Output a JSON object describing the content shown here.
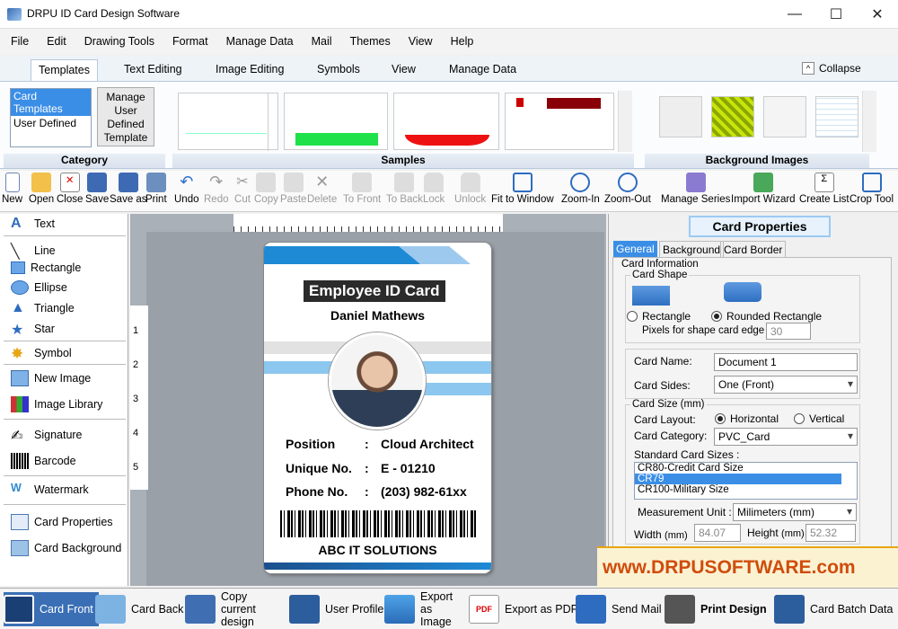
{
  "window": {
    "title": "DRPU ID Card Design Software",
    "minimize": "—",
    "maximize": "☐",
    "close": "✕"
  },
  "menu": [
    "File",
    "Edit",
    "Drawing Tools",
    "Format",
    "Manage Data",
    "Mail",
    "Themes",
    "View",
    "Help"
  ],
  "ribbon_tabs": [
    "Templates",
    "Text Editing",
    "Image Editing",
    "Symbols",
    "View",
    "Manage Data"
  ],
  "collapse_label": "Collapse",
  "category": {
    "items": [
      "Card Templates",
      "User Defined"
    ],
    "manage_button": "Manage User Defined Template",
    "label": "Category"
  },
  "samples_label": "Samples",
  "background_images_label": "Background Images",
  "toolbar": [
    "New",
    "Open",
    "Close",
    "Save",
    "Save as",
    "Print",
    "Undo",
    "Redo",
    "Cut",
    "Copy",
    "Paste",
    "Delete",
    "To Front",
    "To Back",
    "Lock",
    "Unlock",
    "Fit to Window",
    "Zoom-In",
    "Zoom-Out",
    "Manage Series",
    "Import Wizard",
    "Create List",
    "Crop Tool"
  ],
  "tools": [
    "Text",
    "Line",
    "Rectangle",
    "Ellipse",
    "Triangle",
    "Star",
    "Symbol",
    "New Image",
    "Image Library",
    "Signature",
    "Barcode",
    "Watermark",
    "Card Properties",
    "Card Background"
  ],
  "ruler_left": [
    "1",
    "2",
    "3",
    "4",
    "5"
  ],
  "card": {
    "title": "Employee ID Card",
    "name": "Daniel Mathews",
    "rows": [
      {
        "label": "Position",
        "value": "Cloud Architect"
      },
      {
        "label": "Unique No.",
        "value": "E - 01210"
      },
      {
        "label": "Phone No.",
        "value": "(203) 982-61xx"
      }
    ],
    "company": "ABC IT SOLUTIONS",
    "colors": {
      "accent": "#1e8ad6",
      "dark": "#1b4f8e",
      "title_bg": "#2b2b2b"
    }
  },
  "properties": {
    "header": "Card Properties",
    "tabs": [
      "General",
      "Background",
      "Card Border"
    ],
    "card_information": "Card Information",
    "card_shape": "Card Shape",
    "shape_rect": "Rectangle",
    "shape_round": "Rounded Rectangle",
    "pixels_label": "Pixels for shape card edge :",
    "pixels_value": "30",
    "card_name_label": "Card Name:",
    "card_name_value": "Document 1",
    "card_sides_label": "Card Sides:",
    "card_sides_value": "One (Front)",
    "card_size": "Card Size (mm)",
    "layout_label": "Card Layout:",
    "layout_h": "Horizontal",
    "layout_v": "Vertical",
    "category_label": "Card Category:",
    "category_value": "PVC_Card",
    "standard_sizes_label": "Standard Card Sizes :",
    "standard_sizes": [
      "CR80-Credit Card Size",
      "CR79",
      "CR100-Military Size"
    ],
    "unit_label": "Measurement Unit :",
    "unit_value": "Milimeters (mm)",
    "width_label": "Width",
    "width_unit": "(mm)",
    "width_value": "84.07",
    "height_label": "Height",
    "height_unit": "(mm)",
    "height_value": "52.32"
  },
  "watermark_url": "www.DRPUSOFTWARE.com",
  "bottom": [
    "Card Front",
    "Card Back",
    "Copy current design",
    "User Profile",
    "Export as Image",
    "Export as PDF",
    "Send Mail",
    "Print Design",
    "Card Batch Data"
  ]
}
